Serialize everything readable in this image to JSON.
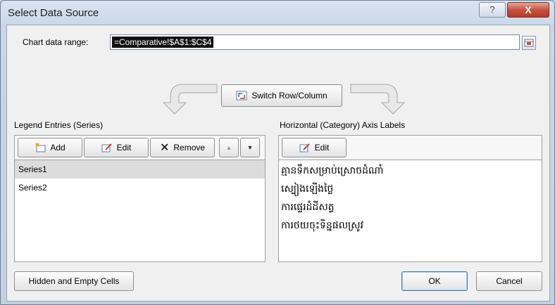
{
  "window": {
    "title": "Select Data Source",
    "help_glyph": "?",
    "close_glyph": "X"
  },
  "range": {
    "label": "Chart data range:",
    "value": "=Comparative!$A$1:$C$4"
  },
  "switch": {
    "label": "Switch Row/Column"
  },
  "legend": {
    "label": "Legend Entries (Series)",
    "add": "Add",
    "edit": "Edit",
    "remove": "Remove",
    "up_glyph": "▲",
    "down_glyph": "▼",
    "series": [
      "Series1",
      "Series2"
    ]
  },
  "category": {
    "label": "Horizontal (Category) Axis Labels",
    "edit": "Edit",
    "items": [
      "គ្មានទឹកសម្រាប់ស្រោចដំណាំ",
      "ស្បៀងឡើងថ្លៃ",
      "ការផ្ទេរដំដីសត្វ",
      "ការថយចុះទិន្នផលស្រូវ"
    ]
  },
  "buttons": {
    "hidden": "Hidden and Empty Cells",
    "ok": "OK",
    "cancel": "Cancel"
  }
}
